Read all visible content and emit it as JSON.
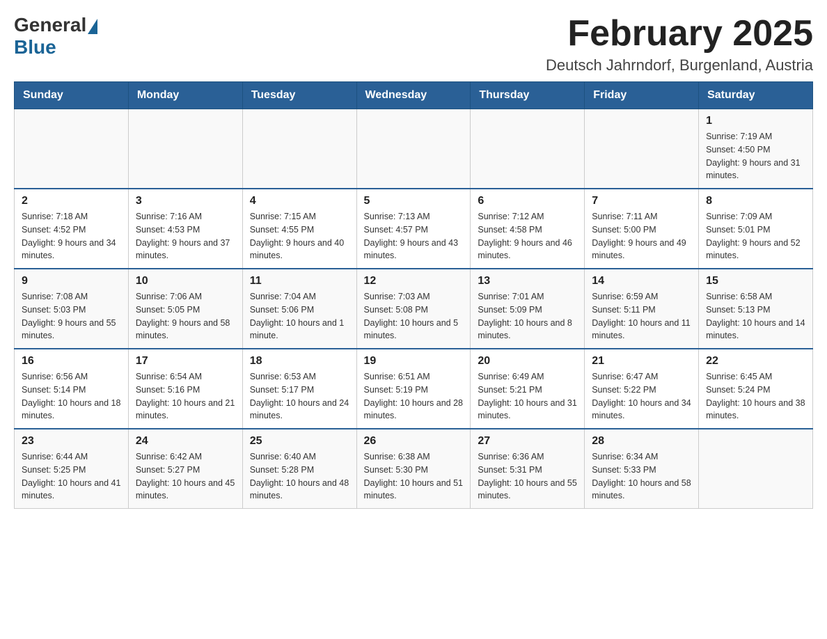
{
  "header": {
    "logo_general": "General",
    "logo_blue": "Blue",
    "title": "February 2025",
    "subtitle": "Deutsch Jahrndorf, Burgenland, Austria"
  },
  "weekdays": [
    "Sunday",
    "Monday",
    "Tuesday",
    "Wednesday",
    "Thursday",
    "Friday",
    "Saturday"
  ],
  "weeks": [
    [
      {
        "day": "",
        "info": ""
      },
      {
        "day": "",
        "info": ""
      },
      {
        "day": "",
        "info": ""
      },
      {
        "day": "",
        "info": ""
      },
      {
        "day": "",
        "info": ""
      },
      {
        "day": "",
        "info": ""
      },
      {
        "day": "1",
        "info": "Sunrise: 7:19 AM\nSunset: 4:50 PM\nDaylight: 9 hours and 31 minutes."
      }
    ],
    [
      {
        "day": "2",
        "info": "Sunrise: 7:18 AM\nSunset: 4:52 PM\nDaylight: 9 hours and 34 minutes."
      },
      {
        "day": "3",
        "info": "Sunrise: 7:16 AM\nSunset: 4:53 PM\nDaylight: 9 hours and 37 minutes."
      },
      {
        "day": "4",
        "info": "Sunrise: 7:15 AM\nSunset: 4:55 PM\nDaylight: 9 hours and 40 minutes."
      },
      {
        "day": "5",
        "info": "Sunrise: 7:13 AM\nSunset: 4:57 PM\nDaylight: 9 hours and 43 minutes."
      },
      {
        "day": "6",
        "info": "Sunrise: 7:12 AM\nSunset: 4:58 PM\nDaylight: 9 hours and 46 minutes."
      },
      {
        "day": "7",
        "info": "Sunrise: 7:11 AM\nSunset: 5:00 PM\nDaylight: 9 hours and 49 minutes."
      },
      {
        "day": "8",
        "info": "Sunrise: 7:09 AM\nSunset: 5:01 PM\nDaylight: 9 hours and 52 minutes."
      }
    ],
    [
      {
        "day": "9",
        "info": "Sunrise: 7:08 AM\nSunset: 5:03 PM\nDaylight: 9 hours and 55 minutes."
      },
      {
        "day": "10",
        "info": "Sunrise: 7:06 AM\nSunset: 5:05 PM\nDaylight: 9 hours and 58 minutes."
      },
      {
        "day": "11",
        "info": "Sunrise: 7:04 AM\nSunset: 5:06 PM\nDaylight: 10 hours and 1 minute."
      },
      {
        "day": "12",
        "info": "Sunrise: 7:03 AM\nSunset: 5:08 PM\nDaylight: 10 hours and 5 minutes."
      },
      {
        "day": "13",
        "info": "Sunrise: 7:01 AM\nSunset: 5:09 PM\nDaylight: 10 hours and 8 minutes."
      },
      {
        "day": "14",
        "info": "Sunrise: 6:59 AM\nSunset: 5:11 PM\nDaylight: 10 hours and 11 minutes."
      },
      {
        "day": "15",
        "info": "Sunrise: 6:58 AM\nSunset: 5:13 PM\nDaylight: 10 hours and 14 minutes."
      }
    ],
    [
      {
        "day": "16",
        "info": "Sunrise: 6:56 AM\nSunset: 5:14 PM\nDaylight: 10 hours and 18 minutes."
      },
      {
        "day": "17",
        "info": "Sunrise: 6:54 AM\nSunset: 5:16 PM\nDaylight: 10 hours and 21 minutes."
      },
      {
        "day": "18",
        "info": "Sunrise: 6:53 AM\nSunset: 5:17 PM\nDaylight: 10 hours and 24 minutes."
      },
      {
        "day": "19",
        "info": "Sunrise: 6:51 AM\nSunset: 5:19 PM\nDaylight: 10 hours and 28 minutes."
      },
      {
        "day": "20",
        "info": "Sunrise: 6:49 AM\nSunset: 5:21 PM\nDaylight: 10 hours and 31 minutes."
      },
      {
        "day": "21",
        "info": "Sunrise: 6:47 AM\nSunset: 5:22 PM\nDaylight: 10 hours and 34 minutes."
      },
      {
        "day": "22",
        "info": "Sunrise: 6:45 AM\nSunset: 5:24 PM\nDaylight: 10 hours and 38 minutes."
      }
    ],
    [
      {
        "day": "23",
        "info": "Sunrise: 6:44 AM\nSunset: 5:25 PM\nDaylight: 10 hours and 41 minutes."
      },
      {
        "day": "24",
        "info": "Sunrise: 6:42 AM\nSunset: 5:27 PM\nDaylight: 10 hours and 45 minutes."
      },
      {
        "day": "25",
        "info": "Sunrise: 6:40 AM\nSunset: 5:28 PM\nDaylight: 10 hours and 48 minutes."
      },
      {
        "day": "26",
        "info": "Sunrise: 6:38 AM\nSunset: 5:30 PM\nDaylight: 10 hours and 51 minutes."
      },
      {
        "day": "27",
        "info": "Sunrise: 6:36 AM\nSunset: 5:31 PM\nDaylight: 10 hours and 55 minutes."
      },
      {
        "day": "28",
        "info": "Sunrise: 6:34 AM\nSunset: 5:33 PM\nDaylight: 10 hours and 58 minutes."
      },
      {
        "day": "",
        "info": ""
      }
    ]
  ]
}
